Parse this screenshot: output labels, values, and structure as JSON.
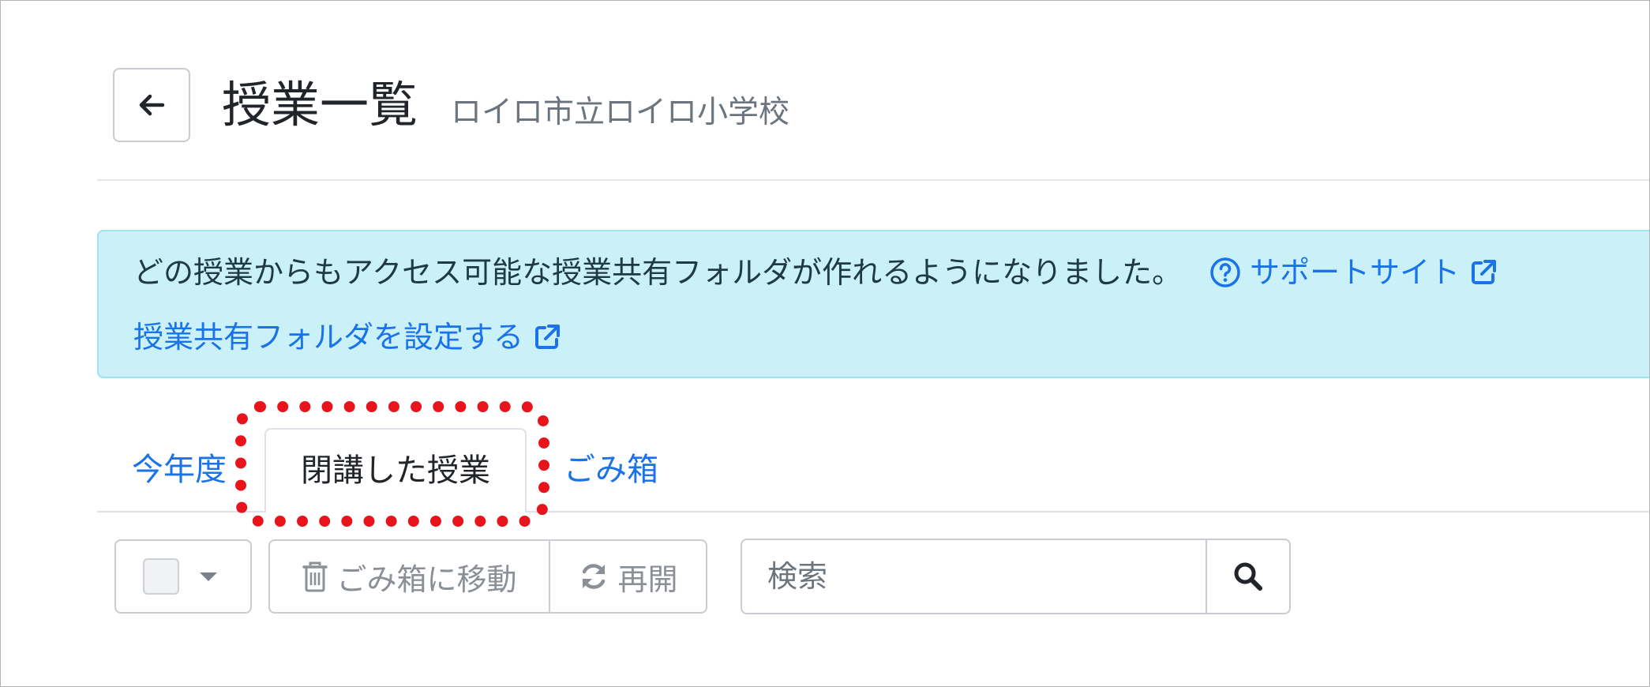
{
  "header": {
    "title": "授業一覧",
    "subtitle": "ロイロ市立ロイロ小学校"
  },
  "alert": {
    "message": "どの授業からもアクセス可能な授業共有フォルダが作れるようになりました。",
    "support_link": "サポートサイト",
    "settings_link": "授業共有フォルダを設定する"
  },
  "tabs": [
    {
      "label": "今年度"
    },
    {
      "label": "閉講した授業"
    },
    {
      "label": "ごみ箱"
    }
  ],
  "toolbar": {
    "trash_label": "ごみ箱に移動",
    "reopen_label": "再開"
  },
  "search": {
    "placeholder": "検索"
  },
  "colors": {
    "link": "#1a73e8",
    "alert_bg": "#cbf1f8",
    "highlight": "#e8141c"
  }
}
